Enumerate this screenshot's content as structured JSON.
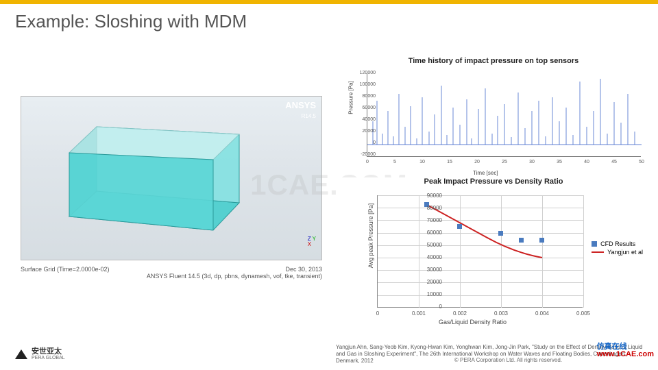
{
  "title": "Example: Sloshing with MDM",
  "sim": {
    "ansys_top": "ANSYS",
    "ansys_ver": "R14.5",
    "surface_label": "Surface Grid (Time=2.0000e-02)",
    "date": "Dec 30, 2013",
    "solver": "ANSYS Fluent 14.5 (3d, dp, pbns, dynamesh, vof, tke, transient)"
  },
  "chart_data": [
    {
      "type": "line",
      "title": "Time history of impact pressure on top sensors",
      "xlabel": "Time [sec]",
      "ylabel": "Pressure [Pa]",
      "ylim": [
        -20000,
        120000
      ],
      "yticks": [
        -20000,
        0,
        20000,
        40000,
        60000,
        80000,
        100000,
        120000
      ],
      "xlim": [
        0,
        50
      ],
      "xticks": [
        0,
        5,
        10,
        15,
        20,
        25,
        30,
        35,
        40,
        45,
        50
      ],
      "note": "dense impulsive spikes, single series (blue)"
    },
    {
      "type": "scatter+line",
      "title": "Peak Impact Pressure vs Density Ratio",
      "xlabel": "Gas/Liquid Density Ratio",
      "ylabel": "Avg peak Pressure [Pa]",
      "ylim": [
        0,
        90000
      ],
      "yticks": [
        0,
        10000,
        20000,
        30000,
        40000,
        50000,
        60000,
        70000,
        80000,
        90000
      ],
      "xlim": [
        0,
        0.005
      ],
      "xticks": [
        0,
        0.001,
        0.002,
        0.003,
        0.004,
        0.005
      ],
      "series": [
        {
          "name": "CFD Results",
          "style": "points",
          "color": "#4a7bbf",
          "x": [
            0.0012,
            0.002,
            0.003,
            0.0035,
            0.004
          ],
          "y": [
            83000,
            65000,
            60000,
            54000,
            54000
          ]
        },
        {
          "name": "Yangjun et al",
          "style": "line",
          "color": "#c22",
          "x": [
            0.0012,
            0.002,
            0.003,
            0.004
          ],
          "y": [
            82000,
            60000,
            47000,
            40000
          ]
        }
      ]
    }
  ],
  "legend2": {
    "a": "CFD Results",
    "b": "Yangjun et al"
  },
  "citation": "Yangjun Ahn, Sang-Yeob Kim, Kyong-Hwan Kim, Yonghwan Kim, Jong-Jin Park, \"Study on the Effect of Density Ratio of Liquid and Gas in Sloshing Experiment\", The 26th International Workshop on Water Waves and Floating Bodies, Copenhagen, Denmark, 2012",
  "footer": {
    "brand_cn": "安世亚太",
    "brand_en": "PERA GLOBAL",
    "copyright": "©  PERA Corporation Ltd. All rights reserved."
  },
  "watermark": {
    "top": "仿真在线",
    "bottom": "www.1CAE.com",
    "center": "1CAE.COM"
  }
}
